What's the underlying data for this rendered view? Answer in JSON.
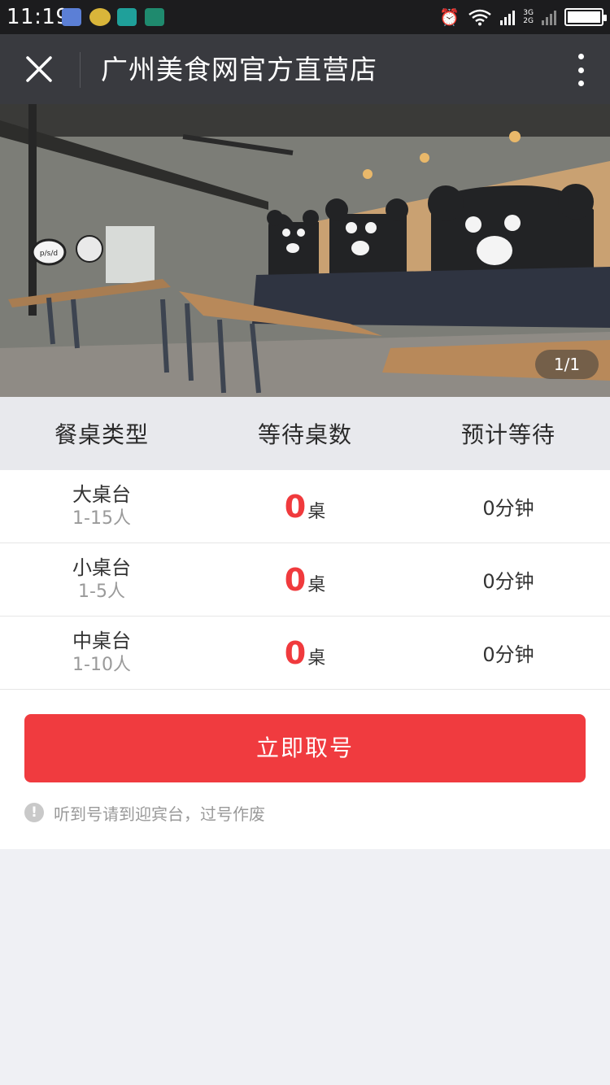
{
  "status_bar": {
    "time": "11:19",
    "network_top": "3G",
    "network_bottom": "2G"
  },
  "title_bar": {
    "title": "广州美食网官方直营店"
  },
  "hero": {
    "pager": "1/1",
    "sign_text": "p/s/d"
  },
  "table": {
    "headers": [
      "餐桌类型",
      "等待桌数",
      "预计等待"
    ],
    "rows": [
      {
        "name": "大桌台",
        "capacity": "1-15人",
        "count": "0",
        "unit": "桌",
        "wait": "0分钟"
      },
      {
        "name": "小桌台",
        "capacity": "1-5人",
        "count": "0",
        "unit": "桌",
        "wait": "0分钟"
      },
      {
        "name": "中桌台",
        "capacity": "1-10人",
        "count": "0",
        "unit": "桌",
        "wait": "0分钟"
      }
    ]
  },
  "action": {
    "button_label": "立即取号",
    "notice": "听到号请到迎宾台，过号作废"
  },
  "colors": {
    "accent_red": "#f03b3f",
    "titlebar": "#393a3f",
    "statusbar": "#1c1c1e"
  }
}
